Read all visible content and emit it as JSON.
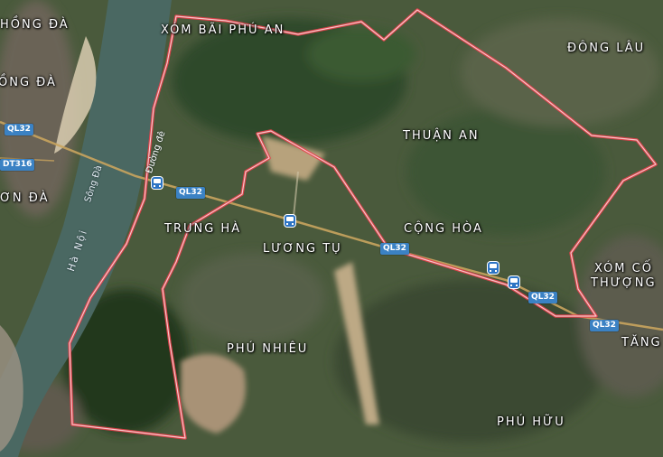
{
  "places": {
    "xom_bai_phu_an": "XÓM BÃI PHÚ AN",
    "hong_da_top": "HỒNG ĐÀ",
    "hong_da_2": "ỒNG ĐÀ",
    "son_da": "ƠN ĐÀ",
    "dong_lau": "ĐÔNG LÂU",
    "thuan_an": "THUẬN AN",
    "trung_ha": "TRUNG HÀ",
    "cong_hoa": "CỘNG HÒA",
    "luong_tu": "LƯƠNG TỤ",
    "xom_co": "XÓM CỐ",
    "thuong": "THƯỢNG",
    "tang": "TĂNG",
    "phu_nhieu": "PHÚ NHIÊU",
    "phu_huu": "PHÚ HỮU"
  },
  "water": {
    "song_da": "Sông Đà",
    "ha_noi": "Hà Nội",
    "duong_de": "Đường đê"
  },
  "roads": {
    "ql32_a": "QL32",
    "ql32_b": "QL32",
    "ql32_c": "QL32",
    "ql32_d": "QL32",
    "ql32_e": "QL32",
    "dt316": "DT316"
  },
  "icons": {
    "bus_stop": "bus-stop-icon"
  },
  "colors": {
    "boundary": "#f2a0a6",
    "road_badge": "#3b82c4",
    "river": "#4a6862"
  }
}
